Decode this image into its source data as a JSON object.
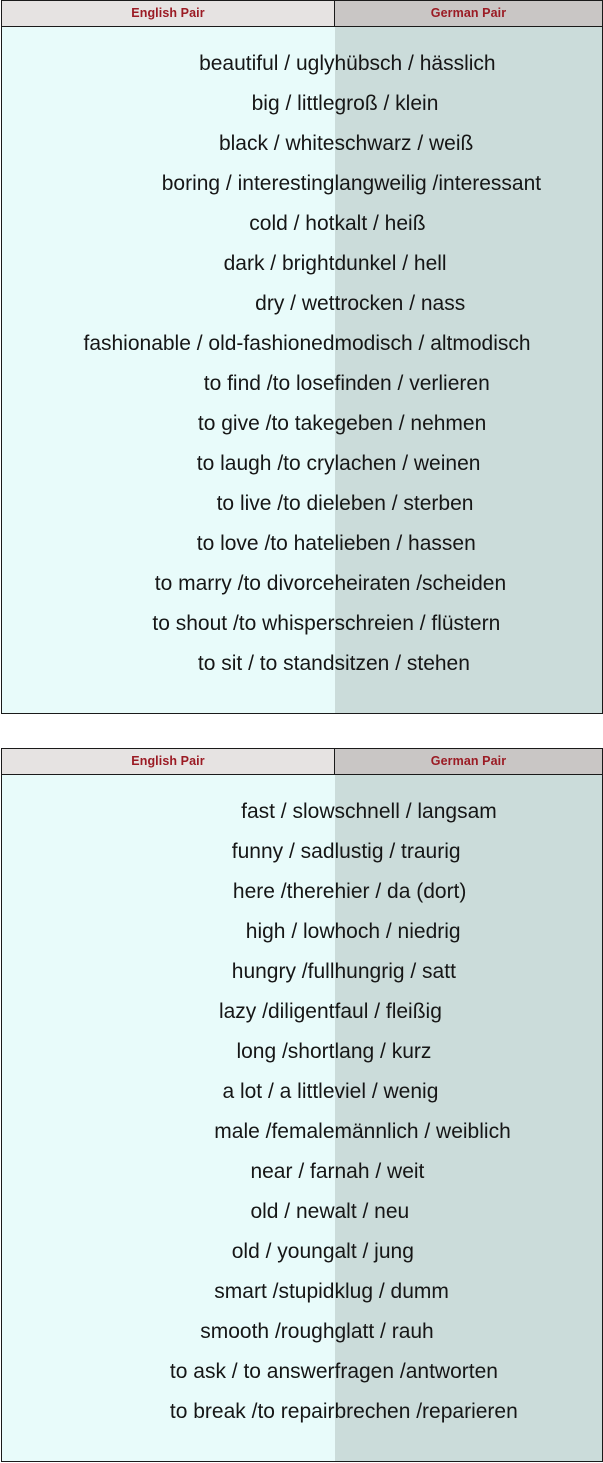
{
  "document": {
    "type": "vocabulary-table",
    "title": "English / German Opposite Word Pairs",
    "colors": {
      "header_text": "#9b1b24",
      "header_bg_english": "#e6e3e2",
      "header_bg_german": "#c9c6c5",
      "cell_bg_english": "#e8fbfa",
      "cell_bg_german": "#cbdcda",
      "border": "#1a1a1a",
      "body_text": "#161616"
    }
  },
  "tables": [
    {
      "id": "table-1",
      "columns": [
        {
          "key": "english",
          "label": "English Pair",
          "align": "right"
        },
        {
          "key": "german",
          "label": "German Pair",
          "align": "left"
        }
      ],
      "rows": [
        {
          "english": "beautiful / ugly",
          "german": "hübsch / hässlich"
        },
        {
          "english": "big / little",
          "german": "groß / klein"
        },
        {
          "english": "black / white",
          "german": "schwarz / weiß"
        },
        {
          "english": "boring / interesting",
          "german": "langweilig /interessant"
        },
        {
          "english": "cold / hot",
          "german": "kalt / heiß"
        },
        {
          "english": "dark / bright",
          "german": "dunkel / hell"
        },
        {
          "english": "dry / wet",
          "german": "trocken / nass"
        },
        {
          "english": "fashionable / old-fashioned",
          "german": "modisch / altmodisch"
        },
        {
          "english": "to find /to lose",
          "german": "finden / verlieren"
        },
        {
          "english": "to give /to take",
          "german": "geben / nehmen"
        },
        {
          "english": "to laugh /to cry",
          "german": "lachen / weinen"
        },
        {
          "english": "to live /to die",
          "german": "leben / sterben"
        },
        {
          "english": "to love /to hate",
          "german": "lieben / hassen"
        },
        {
          "english": "to marry /to divorce",
          "german": "heiraten /scheiden"
        },
        {
          "english": "to shout /to whisper",
          "german": "schreien / flüstern"
        },
        {
          "english": "to sit / to stand",
          "german": "sitzen / stehen"
        }
      ]
    },
    {
      "id": "table-2",
      "columns": [
        {
          "key": "english",
          "label": "English Pair",
          "align": "right"
        },
        {
          "key": "german",
          "label": "German Pair",
          "align": "left"
        }
      ],
      "rows": [
        {
          "english": "fast / slow",
          "german": "schnell / langsam"
        },
        {
          "english": "funny / sad",
          "german": "lustig / traurig"
        },
        {
          "english": "here /there",
          "german": "hier / da (dort)"
        },
        {
          "english": "high / low",
          "german": "hoch / niedrig"
        },
        {
          "english": "hungry /full",
          "german": "hungrig / satt"
        },
        {
          "english": "lazy /diligent",
          "german": "faul / fleißig"
        },
        {
          "english": "long /short",
          "german": "lang / kurz"
        },
        {
          "english": "a lot / a little",
          "german": "viel / wenig"
        },
        {
          "english": "male /female",
          "german": "männlich / weiblich"
        },
        {
          "english": "near / far",
          "german": "nah / weit"
        },
        {
          "english": "old / new",
          "german": "alt / neu"
        },
        {
          "english": "old / young",
          "german": "alt / jung"
        },
        {
          "english": "smart /stupid",
          "german": "klug / dumm"
        },
        {
          "english": "smooth /rough",
          "german": "glatt / rauh"
        },
        {
          "english": "to ask / to answer",
          "german": "fragen /antworten"
        },
        {
          "english": "to break /to repair",
          "german": "brechen /reparieren"
        }
      ]
    }
  ]
}
